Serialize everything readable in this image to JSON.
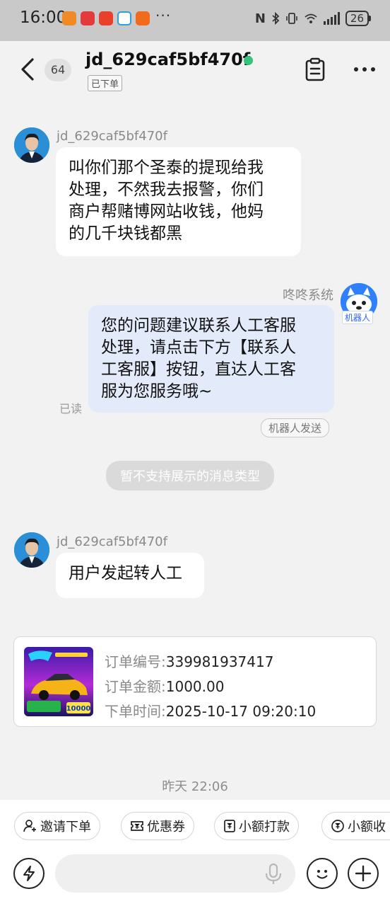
{
  "status_bar": {
    "time": "16:00",
    "battery": "26",
    "more_indicator": "···",
    "network_icons": [
      "nfc-icon",
      "bluetooth-icon",
      "vibrate-icon",
      "wifi-icon",
      "signal-icon"
    ]
  },
  "header": {
    "contact_name": "jd_629caf5bf470f",
    "unread_count": "64",
    "order_status_tag": "已下单",
    "online_color": "#35c27a"
  },
  "messages": [
    {
      "sender": "jd_629caf5bf470f",
      "lines": [
        "叫你们那个圣泰的提现给我",
        "处理，不然我去报警，你们",
        "商户帮赌博网站收钱，他妈",
        "的几千块钱都黑"
      ]
    },
    {
      "sender": "咚咚系统",
      "avatar_label": "机器人",
      "lines": [
        "您的问题建议联系人工客服",
        "处理，请点击下方【联系人",
        "工客服】按钮，直达人工客",
        "服为您服务哦~"
      ],
      "read_status": "已读",
      "tag": "机器人发送"
    },
    {
      "system_notice": "暂不支持展示的消息类型"
    },
    {
      "sender": "jd_629caf5bf470f",
      "lines": [
        "用户发起转人工"
      ]
    }
  ],
  "order_card": {
    "order_no_label": "订单编号:",
    "order_no": "339981937417",
    "amount_label": "订单金额:",
    "amount": "1000.00",
    "time_label": "下单时间:",
    "time": "2025-10-17 09:20:10",
    "thumb_badge": "10000"
  },
  "timestamp": "昨天 22:06",
  "toolbar": {
    "chips": [
      "邀请下单",
      "优惠券",
      "小额打款",
      "小额收"
    ],
    "chip_icons": [
      "person-add-icon",
      "coupon-icon",
      "payment-icon",
      "receive-icon"
    ],
    "input_placeholder": ""
  },
  "colors": {
    "outgoing_bubble": "#e3ebfa",
    "incoming_bubble": "#ffffff",
    "robot_blue": "#2f80ff"
  }
}
